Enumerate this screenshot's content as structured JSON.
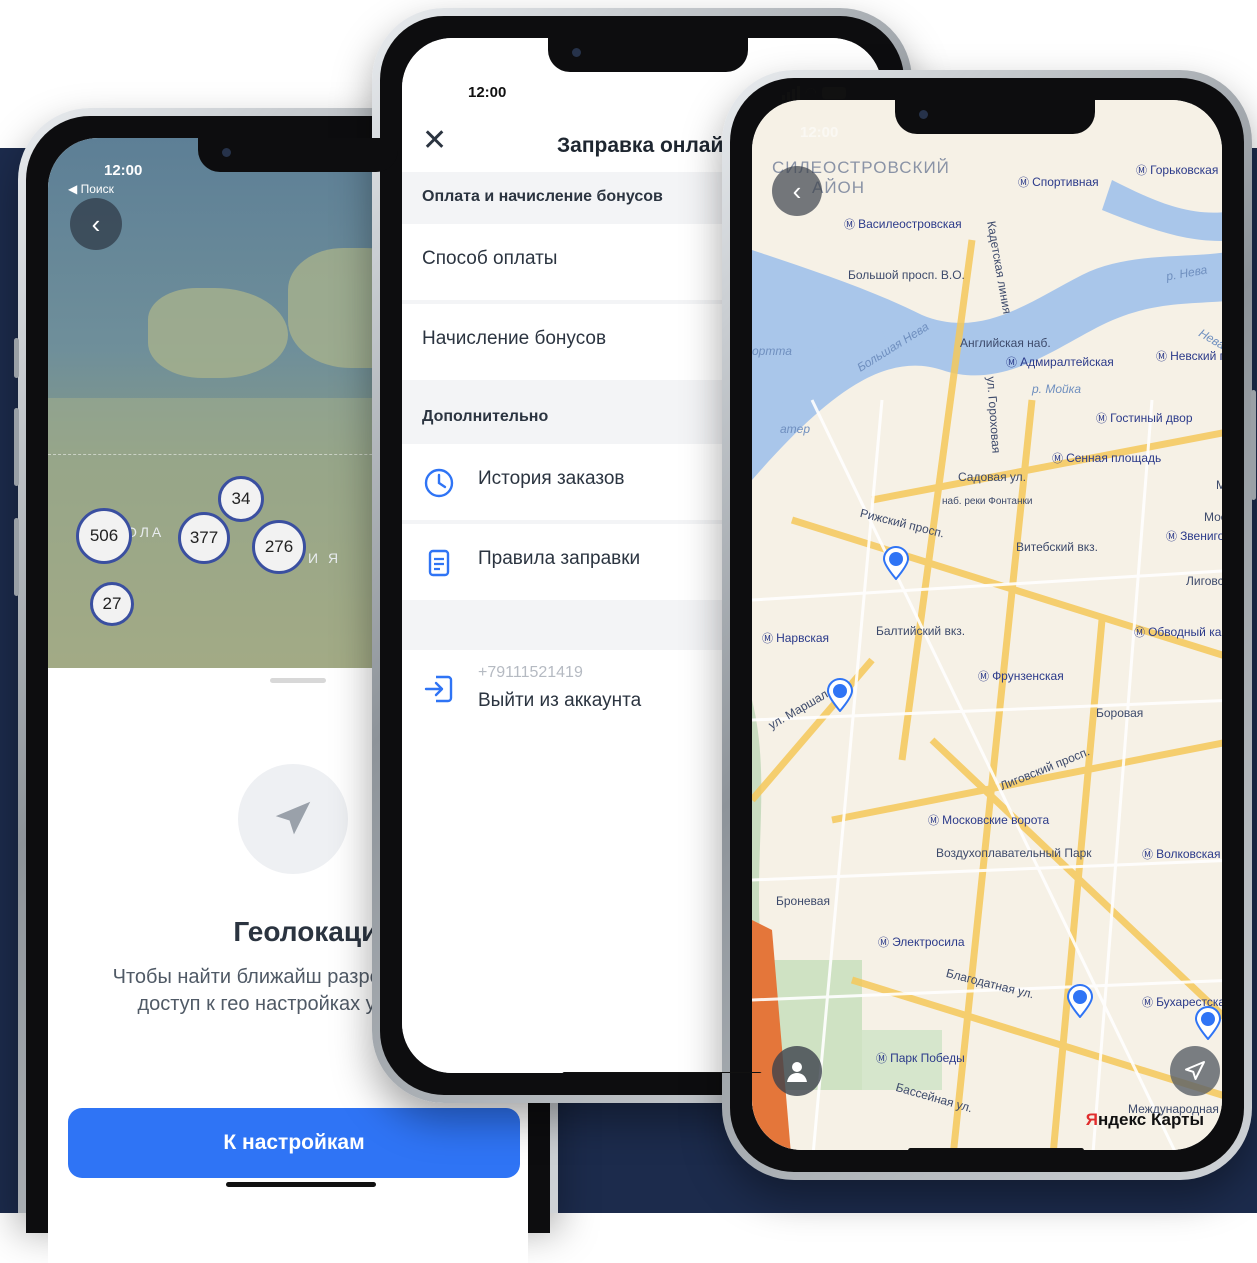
{
  "colors": {
    "background": "#1c2b4c",
    "accent": "#2f74f5",
    "cluster_border": "#3a4fa0",
    "station_icon": "#2f74f5"
  },
  "phone1": {
    "status_time": "12:00",
    "back_hint": "◀ Поиск",
    "clusters": [
      "34",
      "506",
      "377",
      "276",
      "27"
    ],
    "map_fragments": [
      "ОЛА",
      "И Я"
    ],
    "geo_title": "Геолокация",
    "geo_text": "Чтобы найти ближайш разрешите доступ к гео настройках устрой",
    "settings_button": "К настройкам"
  },
  "phone2": {
    "status_time": "12:00",
    "title": "Заправка онлайн",
    "section_payment": "Оплата и начисление бонусов",
    "payment_method": "Способ оплаты",
    "bonus_accrual": "Начисление бонусов",
    "section_extra": "Дополнительно",
    "order_history": "История заказов",
    "fuel_rules": "Правила заправки",
    "phone_number": "+79111521419",
    "logout": "Выйти из аккаунта",
    "icons": [
      "close-icon",
      "clock-icon",
      "document-icon",
      "logout-icon"
    ]
  },
  "phone3": {
    "status_time": "12:00",
    "district": [
      "СИЛЕОСТРОВСКИЙ",
      "АЙОН"
    ],
    "metro": [
      "Спортивная",
      "Горьковская",
      "Василеостровская",
      "Адмиралтейская",
      "Невский проспект",
      "Гостиный двор",
      "Сенная площадь",
      "Звенигор",
      "Нарвская",
      "Фрунзенская",
      "Обводный канал",
      "Московские ворота",
      "Волковская",
      "Электросила",
      "Парк Победы",
      "Бухарестская"
    ],
    "streets": [
      "Большой просп. В.О.",
      "Кадетская линия",
      "Английская наб.",
      "ул. Гороховая",
      "Садовая ул.",
      "наб. реки Фонтанки",
      "Рижский просп.",
      "Витебский вкз.",
      "Балтийский вкз.",
      "Лиговский просп.",
      "Лиговск просп",
      "Воздухоплавательный Парк",
      "Благодатная ул.",
      "Бассейная ул.",
      "Международная",
      "ул. Маршала",
      "Боровая",
      "Броневая",
      "Мос",
      "Ма"
    ],
    "water": [
      "р. Нева",
      "р. Мойка",
      "Большая Нева",
      "Нева",
      "р. Мойка",
      "ортта",
      "атер"
    ],
    "brand_y": "Я",
    "brand_rest": "ндекс Карты"
  }
}
